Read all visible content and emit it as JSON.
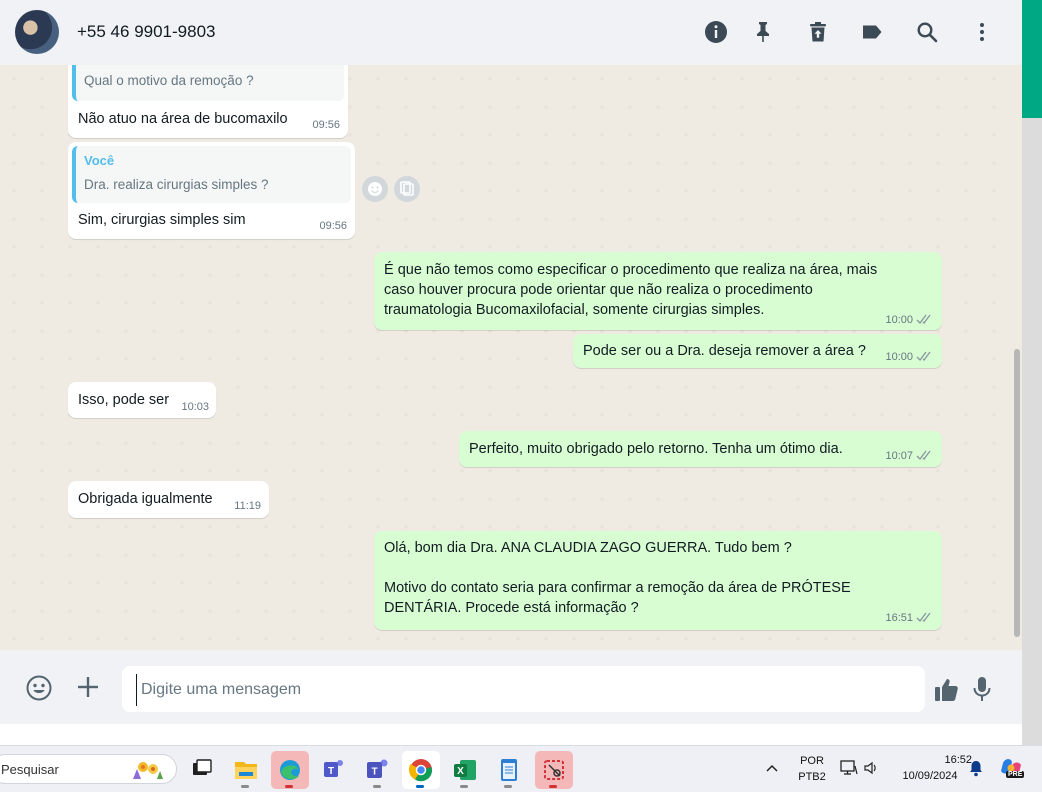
{
  "header": {
    "contact_name": "+55 46 9901-9803",
    "icons": [
      "info-icon",
      "pin-icon",
      "delete-icon",
      "label-icon",
      "search-icon",
      "menu-icon"
    ]
  },
  "messages": [
    {
      "direction": "in",
      "quote_text": "Qual o motivo da remoção ?",
      "text": "Não atuo na área de bucomaxilo",
      "time": "09:56"
    },
    {
      "direction": "in",
      "quote_sender": "Você",
      "quote_text": "Dra. realiza cirurgias simples ?",
      "text": "Sim, cirurgias simples sim",
      "time": "09:56"
    },
    {
      "direction": "out",
      "text": "É que não temos como especificar o procedimento que realiza na área, mais\ncaso houver procura pode orientar que não realiza o procedimento\ntraumatologia Bucomaxilofacial, somente cirurgias simples.",
      "time": "10:00"
    },
    {
      "direction": "out",
      "text": "Pode ser ou a Dra. deseja remover a área ?",
      "time": "10:00"
    },
    {
      "direction": "in",
      "text": "Isso, pode ser",
      "time": "10:03"
    },
    {
      "direction": "out",
      "text": "Perfeito, muito obrigado pelo retorno. Tenha um ótimo dia.",
      "time": "10:07"
    },
    {
      "direction": "in",
      "text": "Obrigada igualmente",
      "time": "11:19"
    },
    {
      "direction": "out",
      "text": "Olá, bom dia Dra. ANA CLAUDIA ZAGO GUERRA. Tudo bem ?\n\nMotivo do contato seria para confirmar a remoção da área de PRÓTESE\nDENTÁRIA. Procede está informação ?",
      "time": "16:51"
    }
  ],
  "composer": {
    "placeholder": "Digite uma mensagem"
  },
  "taskbar": {
    "search_label": "Pesquisar",
    "language": "POR",
    "keyboard": "PTB2",
    "time": "16:52",
    "date": "10/09/2024",
    "copilot_badge": "PRE"
  },
  "colors": {
    "accent": "#00a884",
    "outgoing_bubble": "#d9fdd3",
    "quote_bar": "#53bdeb",
    "read_ticks": "#8696a0"
  }
}
